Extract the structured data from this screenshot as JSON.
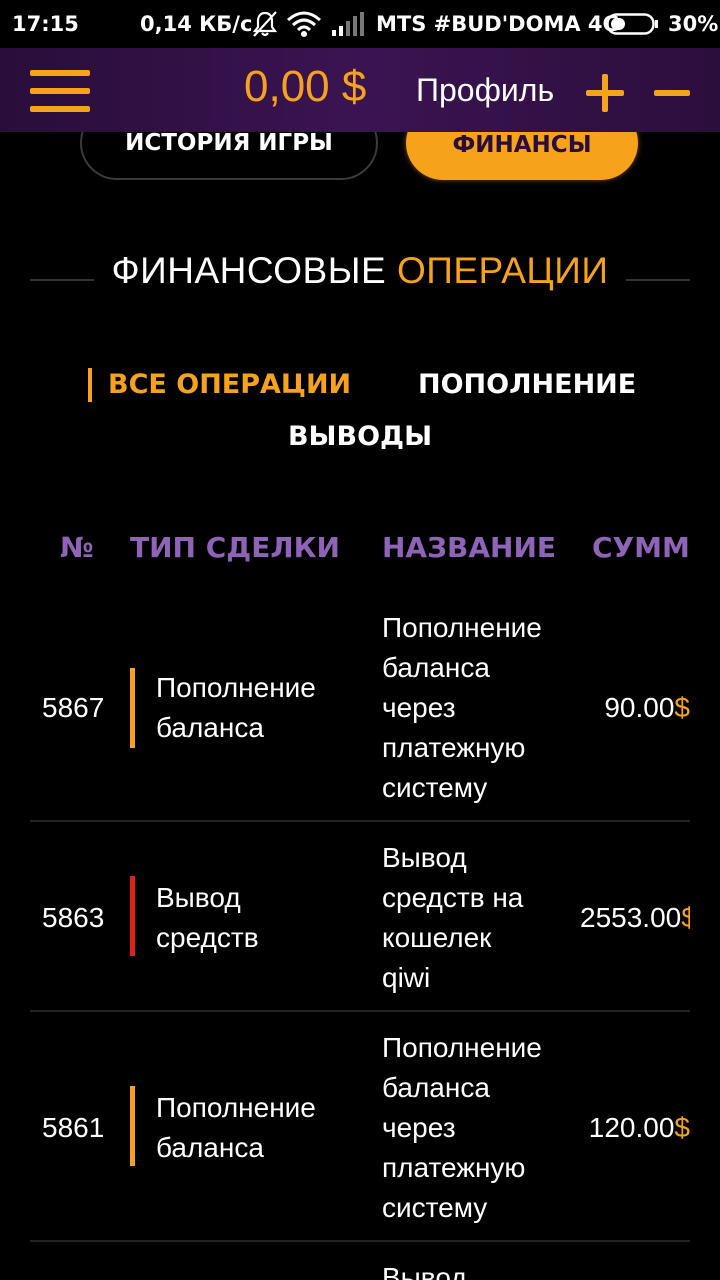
{
  "status_bar": {
    "time": "17:15",
    "speed": "0,14 КБ/с",
    "carrier": "MTS #BUD'DOMA 4G",
    "battery": "30%",
    "icons": [
      "bell-muted-icon",
      "wifi-icon",
      "signal-icon",
      "battery-icon"
    ]
  },
  "header": {
    "balance": "0,00 $",
    "profile_label": "Профиль",
    "accent_color": "#f7a21b"
  },
  "tabs": [
    {
      "label": "ИСТОРИЯ ИГРЫ",
      "active": false
    },
    {
      "label": "ФИНАНСЫ",
      "active": true
    }
  ],
  "section": {
    "title_part1": "ФИНАНСОВЫЕ",
    "title_part2": "ОПЕРАЦИИ"
  },
  "filters": [
    {
      "label": "ВСЕ ОПЕРАЦИИ",
      "active": true
    },
    {
      "label": "ПОПОЛНЕНИЕ",
      "active": false
    },
    {
      "label": "ВЫВОДЫ",
      "active": false
    }
  ],
  "table": {
    "columns": [
      "№",
      "ТИП СДЕЛКИ",
      "НАЗВАНИЕ",
      "СУММА"
    ],
    "rows": [
      {
        "num": "5867",
        "type_line1": "Пополнение",
        "type_line2": "баланса",
        "name": [
          "Пополнение",
          "баланса",
          "через",
          "платежную",
          "систему"
        ],
        "sum": "90.00",
        "currency": "$",
        "status": "deposit",
        "bar_color": "#f7a21b"
      },
      {
        "num": "5863",
        "type_line1": "Вывод",
        "type_line2": "средств",
        "name": [
          "Вывод",
          "средств на",
          "кошелек",
          "qiwi"
        ],
        "sum": "2553.00",
        "currency": "$",
        "status": "withdrawal",
        "bar_color": "#e0201e"
      },
      {
        "num": "5861",
        "type_line1": "Пополнение",
        "type_line2": "баланса",
        "name": [
          "Пополнение",
          "баланса",
          "через",
          "платежную",
          "систему"
        ],
        "sum": "120.00",
        "currency": "$",
        "status": "deposit",
        "bar_color": "#f7a21b"
      }
    ],
    "partial_next_row_name": "Вывод"
  }
}
